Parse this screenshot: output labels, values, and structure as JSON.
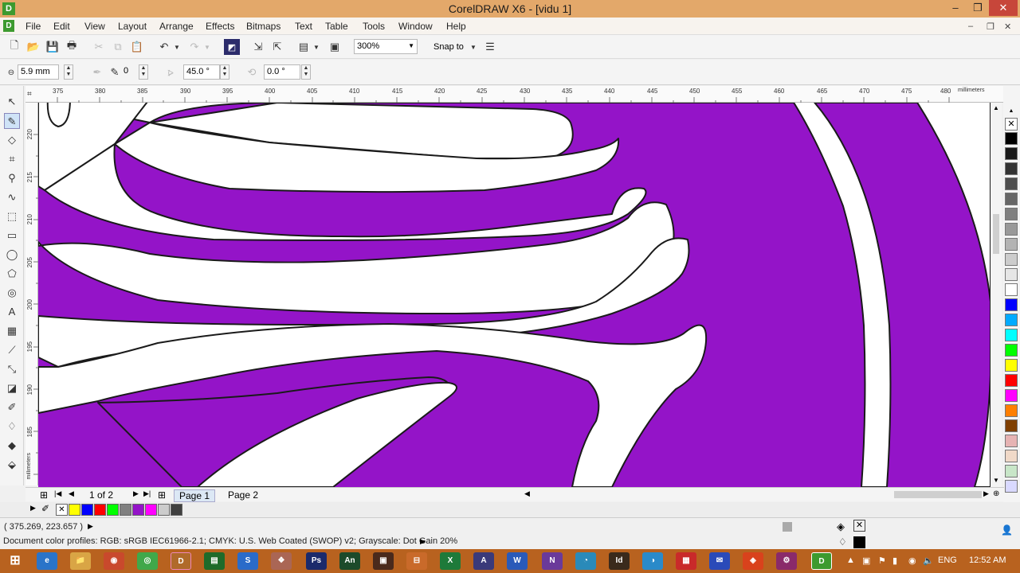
{
  "window": {
    "title": "CorelDRAW X6 - [vidu 1]",
    "minimize": "–",
    "maximize": "❐",
    "close": "✕"
  },
  "menu": {
    "items": [
      "File",
      "Edit",
      "View",
      "Layout",
      "Arrange",
      "Effects",
      "Bitmaps",
      "Text",
      "Table",
      "Tools",
      "Window",
      "Help"
    ]
  },
  "standard_toolbar": {
    "zoom_value": "300%",
    "snap_label": "Snap to"
  },
  "property_bar": {
    "nib_size": "5.9 mm",
    "smoothing": "0",
    "angle1": "45.0 °",
    "angle2": "0.0 °"
  },
  "rulers": {
    "horizontal_ticks": [
      "375",
      "380",
      "385",
      "390",
      "395",
      "400",
      "405",
      "410",
      "415",
      "420",
      "425",
      "430",
      "435",
      "440",
      "445",
      "450",
      "455",
      "460",
      "465",
      "470",
      "475",
      "480"
    ],
    "horizontal_unit": "millimeters",
    "vertical_ticks": [
      "220",
      "215",
      "210",
      "205",
      "200",
      "195",
      "190",
      "185"
    ],
    "vertical_unit": "millimeters"
  },
  "page_nav": {
    "count": "1 of 2",
    "tabs": [
      "Page 1",
      "Page 2"
    ]
  },
  "status": {
    "coords": "( 375.269, 223.657 )",
    "profiles": "Document color profiles: RGB: sRGB IEC61966-2.1; CMYK: U.S. Web Coated (SWOP) v2; Grayscale: Dot Gain 20%"
  },
  "taskbar": {
    "lang": "ENG",
    "time": "12:52 AM"
  },
  "colors": {
    "fill": "#9414c8",
    "palette": [
      "#000000",
      "#1a1a1a",
      "#333333",
      "#4d4d4d",
      "#666666",
      "#808080",
      "#999999",
      "#b3b3b3",
      "#cccccc",
      "#e6e6e6",
      "#ffffff",
      "#0000ff",
      "#00aaff",
      "#00ffff",
      "#00ff00",
      "#ffff00",
      "#ff0000",
      "#ff00ff",
      "#ff7f00",
      "#7f3f00",
      "#e6b3b3",
      "#f0d9c8",
      "#c8e6c8",
      "#d9d9ff"
    ],
    "doc_palette": [
      "#ffff00",
      "#0000ff",
      "#ff0000",
      "#00ff00",
      "#808080",
      "#9414c8",
      "#ff00ff",
      "#cccccc",
      "#404040"
    ]
  }
}
